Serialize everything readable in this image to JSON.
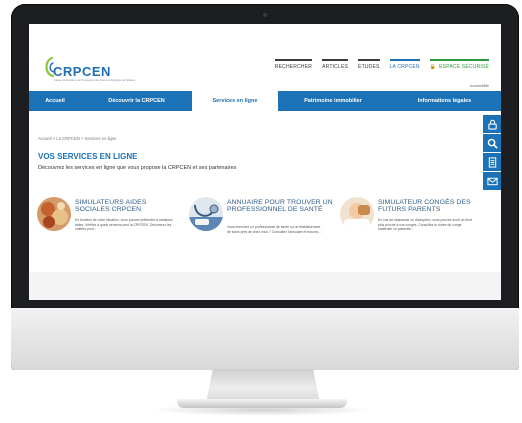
{
  "logo": {
    "name": "CRPCEN",
    "tagline": "Caisse de Retraite et de Prévoyance des Clercs et Employés de Notaires"
  },
  "topnav": [
    {
      "label": "RECHERCHER",
      "style": "dark"
    },
    {
      "label": "ARTICLES",
      "style": "dark"
    },
    {
      "label": "ÉTUDES",
      "style": "dark"
    },
    {
      "label": "LA CRPCEN",
      "style": "blue"
    },
    {
      "label": "ESPACE SÉCURISÉ",
      "style": "green",
      "icon": "lock-icon"
    }
  ],
  "account_link": "Accessibilité",
  "mainnav": [
    {
      "label": "Accueil",
      "active": false
    },
    {
      "label": "Découvrir la CRPCEN",
      "active": false
    },
    {
      "label": "Services en ligne",
      "active": true
    },
    {
      "label": "Patrimoine immobilier",
      "active": false
    },
    {
      "label": "Informations légales",
      "active": false
    }
  ],
  "sidetools": [
    "accessibility-lock-icon",
    "search-icon",
    "document-icon",
    "mail-icon"
  ],
  "breadcrumb": "Accueil > La CRPCEN > Services en ligne",
  "page": {
    "title": "VOS SERVICES EN LIGNE",
    "subtitle": "Découvrez les services en ligne que vous propose la CRPCEN et ses partenaires"
  },
  "cards": [
    {
      "title": "SIMULATEURS AIDES SOCIALES CRPCEN",
      "desc": "En fonction de votre situation, vous pouvez prétendre à certaines aides. Vérifiez à quels services peut la CRPCEN. Découvrez les critères pour...",
      "thumb": "food-photo"
    },
    {
      "title": "ANNUAIRE POUR TROUVER UN PROFESSIONNEL DE SANTÉ",
      "desc": "Vous cherchez un professionnel de santé ou un établissement de soins près de chez vous ? Consultez l'annuaire et trouvez...",
      "thumb": "stethoscope-photo"
    },
    {
      "title": "SIMULATEUR CONGÉS DES FUTURS PARENTS",
      "desc": "En cas de naissance ou d'adoption, vous pouvez avoir un droit plus proche à vos congés. Consultez le durée du congé maternité ou paternité...",
      "thumb": "baby-photo"
    }
  ],
  "colors": {
    "brand_blue": "#1c72b6",
    "title_blue": "#2f5d8a",
    "secure_green": "#2e9a3d"
  }
}
